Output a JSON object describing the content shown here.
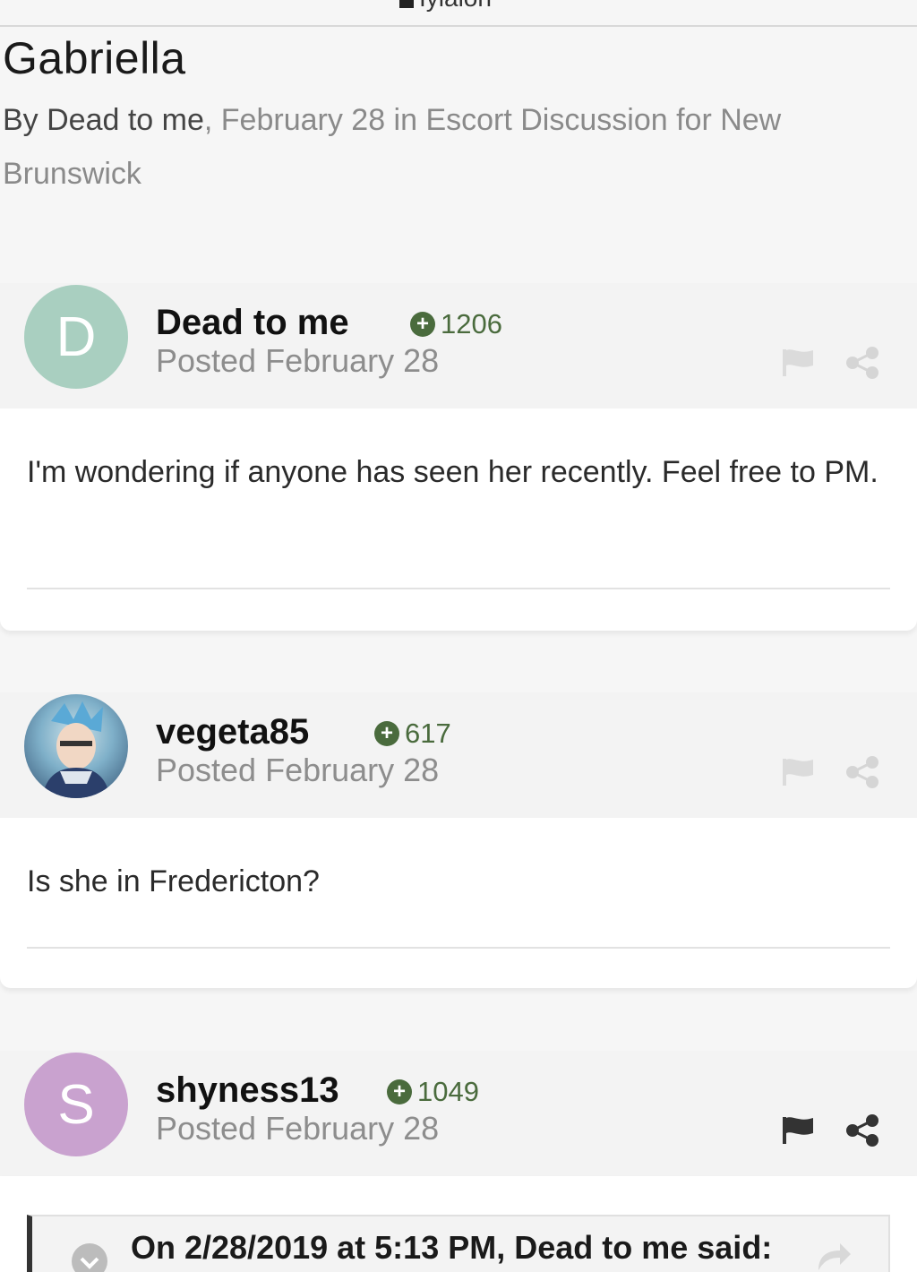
{
  "topbar": {
    "cut_text": "Iylalon"
  },
  "topic": {
    "title": "Gabriella",
    "by_prefix": "By ",
    "author": "Dead to me",
    "meta_rest": ", February 28 in Escort Discussion for New Brunswick"
  },
  "posts": [
    {
      "avatar_letter": "D",
      "avatar_color": "#a9cfc0",
      "username": "Dead to me",
      "reputation": "1206",
      "posted": "Posted February 28",
      "content": "I'm wondering if anyone has seen her recently. Feel free to PM."
    },
    {
      "avatar_letter": "",
      "avatar_color": "#7fb0c9",
      "username": "vegeta85",
      "reputation": "617",
      "posted": "Posted February 28",
      "content": "Is she in Fredericton?"
    },
    {
      "avatar_letter": "S",
      "avatar_color": "#c9a2cf",
      "username": "shyness13",
      "reputation": "1049",
      "posted": "Posted February 28",
      "quote": "On 2/28/2019 at 5:13 PM, Dead to me said:"
    }
  ],
  "colors": {
    "reputation_green": "#4a6b3d",
    "background": "#f6f6f6"
  },
  "icons": [
    "flag-icon",
    "share-icon",
    "plus-icon",
    "check-icon",
    "reply-arrow-icon"
  ]
}
